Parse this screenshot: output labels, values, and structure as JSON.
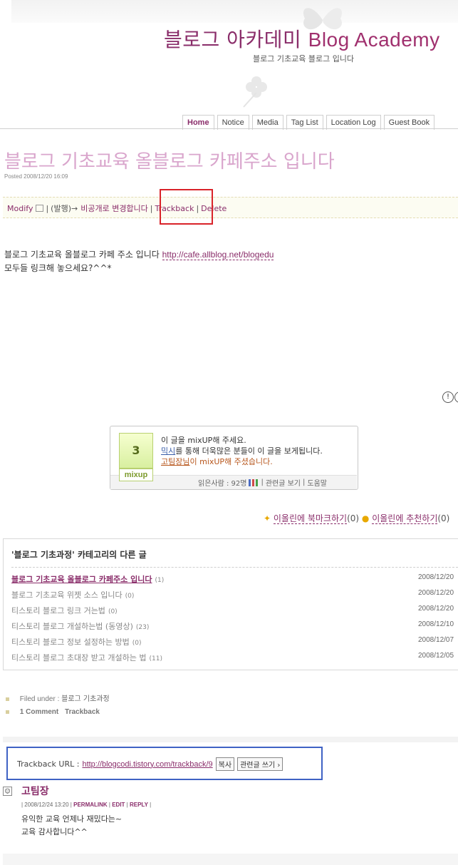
{
  "header": {
    "title_ko": "블로그 아카데미",
    "title_en": "Blog Academy",
    "subtitle": "블로그 기초교육 블로그 입니다"
  },
  "menu": {
    "tabs": [
      {
        "label": "Home"
      },
      {
        "label": "Notice"
      },
      {
        "label": "Media"
      },
      {
        "label": "Tag List"
      },
      {
        "label": "Location Log"
      },
      {
        "label": "Guest Book"
      }
    ]
  },
  "post": {
    "title": "블로그 기초교육 올블로그 카페주소 입니다",
    "posted": "Posted 2008/12/20 16:09",
    "actions": {
      "modify": "Modify",
      "status_prefix": "(발행)→",
      "status_link": "비공개로 변경합니다",
      "trackback": "Trackback",
      "delete": "Delete"
    },
    "body_line1": "블로그 기초교육 올블로그 카페 주소 입니다",
    "body_link": "http://cafe.allblog.net/blogedu",
    "body_line2": "모두들 링크해 놓으세요?^^*"
  },
  "mixup": {
    "count": "3",
    "logo": "mixup",
    "line1": "이 글을 mixUP해 주세요.",
    "line2_link": "믹시",
    "line2_rest": "를 통해 더욱많은 분들이 이 글을 보게됩니다.",
    "line3_link": "고팀장님",
    "line3_rest": "이 mixUP해 주셨습니다.",
    "readers": "읽은사람 : 92명",
    "related_view": "관련글 보기",
    "help": "도움말"
  },
  "allblog": {
    "bookmark": "이올린에 북마크하기",
    "bookmark_count": "(0)",
    "recommend": "이올린에 추천하기",
    "recommend_count": "(0)"
  },
  "related": {
    "heading": "'블로그 기초과정' 카테고리의 다른 글",
    "items": [
      {
        "title": "블로그 기초교육 올블로그 카페주소 입니다",
        "count": "(1)",
        "date": "2008/12/20"
      },
      {
        "title": "블로그 기초교육 위젯 소스 입니다",
        "count": "(0)",
        "date": "2008/12/20"
      },
      {
        "title": "티스토리 블로그 링크 거는법",
        "count": "(0)",
        "date": "2008/12/20"
      },
      {
        "title": "티스토리 블로그 개설하는법 (동영상)",
        "count": "(23)",
        "date": "2008/12/10"
      },
      {
        "title": "티스토리 블로그 정보 설정하는 방법",
        "count": "(0)",
        "date": "2008/12/07"
      },
      {
        "title": "티스토리 블로그 초대장 받고 개설하는 법",
        "count": "(11)",
        "date": "2008/12/05"
      }
    ]
  },
  "meta": {
    "filed_label": "Filed under :",
    "category": "블로그 기초과정",
    "comments": "1 Comment",
    "trackback": "Trackback"
  },
  "trackback": {
    "label": "Trackback URL :",
    "url": "http://blogcodi.tistory.com/trackback/9",
    "copy_btn": "복사",
    "write_btn": "관련글 쓰기 ›"
  },
  "comment": {
    "name": "고팀장",
    "date": "| 2008/12/24 13:20 |",
    "permalink": "PERMALINK",
    "edit": "EDIT",
    "reply": "REPLY",
    "line1": "유익한 교육 언제나 재밌다는~",
    "line2": "교육 감사합니다^^"
  },
  "colors": {
    "accent": "#8a2d6a",
    "title_pink": "#d9a5cc",
    "highlight_red": "#d9232a",
    "highlight_blue": "#3f62c4"
  }
}
